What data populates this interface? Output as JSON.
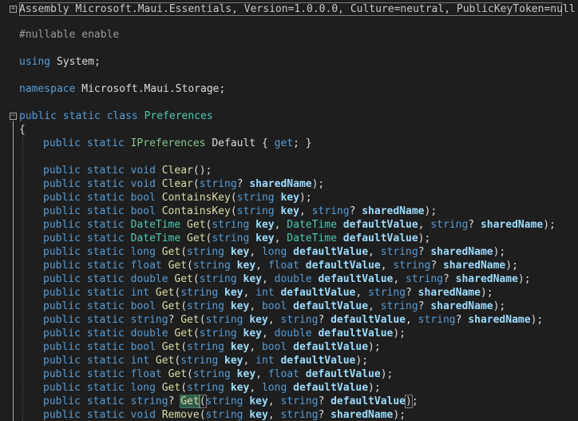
{
  "header": {
    "text": "Assembly Microsoft.Maui.Essentials, Version=1.0.0.0, Culture=neutral, PublicKeyToken=null",
    "expand_glyph": "+"
  },
  "collapse_glyph": "−",
  "preproc": {
    "directive": "#nullable",
    "value": "enable"
  },
  "using": {
    "keyword": "using",
    "name": "System",
    "semi": ";"
  },
  "namespace": {
    "keyword": "namespace",
    "name": "Microsoft.Maui.Storage",
    "semi": ";"
  },
  "class_decl": {
    "public": "public",
    "static": "static",
    "class": "class",
    "name": "Preferences"
  },
  "open_brace": "{",
  "members": [
    [
      [
        "kw",
        "public"
      ],
      [
        "p",
        " "
      ],
      [
        "kw",
        "static"
      ],
      [
        "p",
        " "
      ],
      [
        "st",
        "IPreferences"
      ],
      [
        "p",
        " "
      ],
      [
        "pn",
        "Default"
      ],
      [
        "p",
        " { "
      ],
      [
        "kw",
        "get"
      ],
      [
        "p",
        "; }"
      ]
    ],
    [],
    [
      [
        "kw",
        "public"
      ],
      [
        "p",
        " "
      ],
      [
        "kw",
        "static"
      ],
      [
        "p",
        " "
      ],
      [
        "kw",
        "void"
      ],
      [
        "p",
        " "
      ],
      [
        "fn",
        "Clear"
      ],
      [
        "p",
        "();"
      ]
    ],
    [
      [
        "kw",
        "public"
      ],
      [
        "p",
        " "
      ],
      [
        "kw",
        "static"
      ],
      [
        "p",
        " "
      ],
      [
        "kw",
        "void"
      ],
      [
        "p",
        " "
      ],
      [
        "fn",
        "Clear"
      ],
      [
        "p",
        "("
      ],
      [
        "kw",
        "string"
      ],
      [
        "p",
        "? "
      ],
      [
        "pm",
        "sharedName"
      ],
      [
        "p",
        ");"
      ]
    ],
    [
      [
        "kw",
        "public"
      ],
      [
        "p",
        " "
      ],
      [
        "kw",
        "static"
      ],
      [
        "p",
        " "
      ],
      [
        "kw",
        "bool"
      ],
      [
        "p",
        " "
      ],
      [
        "fn",
        "ContainsKey"
      ],
      [
        "p",
        "("
      ],
      [
        "kw",
        "string"
      ],
      [
        "p",
        " "
      ],
      [
        "pm",
        "key"
      ],
      [
        "p",
        ");"
      ]
    ],
    [
      [
        "kw",
        "public"
      ],
      [
        "p",
        " "
      ],
      [
        "kw",
        "static"
      ],
      [
        "p",
        " "
      ],
      [
        "kw",
        "bool"
      ],
      [
        "p",
        " "
      ],
      [
        "fn",
        "ContainsKey"
      ],
      [
        "p",
        "("
      ],
      [
        "kw",
        "string"
      ],
      [
        "p",
        " "
      ],
      [
        "pm",
        "key"
      ],
      [
        "p",
        ", "
      ],
      [
        "kw",
        "string"
      ],
      [
        "p",
        "? "
      ],
      [
        "pm",
        "sharedName"
      ],
      [
        "p",
        ");"
      ]
    ],
    [
      [
        "kw",
        "public"
      ],
      [
        "p",
        " "
      ],
      [
        "kw",
        "static"
      ],
      [
        "p",
        " "
      ],
      [
        "ty",
        "DateTime"
      ],
      [
        "p",
        " "
      ],
      [
        "fn",
        "Get"
      ],
      [
        "p",
        "("
      ],
      [
        "kw",
        "string"
      ],
      [
        "p",
        " "
      ],
      [
        "pm",
        "key"
      ],
      [
        "p",
        ", "
      ],
      [
        "ty",
        "DateTime"
      ],
      [
        "p",
        " "
      ],
      [
        "pm",
        "defaultValue"
      ],
      [
        "p",
        ", "
      ],
      [
        "kw",
        "string"
      ],
      [
        "p",
        "? "
      ],
      [
        "pm",
        "sharedName"
      ],
      [
        "p",
        ");"
      ]
    ],
    [
      [
        "kw",
        "public"
      ],
      [
        "p",
        " "
      ],
      [
        "kw",
        "static"
      ],
      [
        "p",
        " "
      ],
      [
        "ty",
        "DateTime"
      ],
      [
        "p",
        " "
      ],
      [
        "fn",
        "Get"
      ],
      [
        "p",
        "("
      ],
      [
        "kw",
        "string"
      ],
      [
        "p",
        " "
      ],
      [
        "pm",
        "key"
      ],
      [
        "p",
        ", "
      ],
      [
        "ty",
        "DateTime"
      ],
      [
        "p",
        " "
      ],
      [
        "pm",
        "defaultValue"
      ],
      [
        "p",
        ");"
      ]
    ],
    [
      [
        "kw",
        "public"
      ],
      [
        "p",
        " "
      ],
      [
        "kw",
        "static"
      ],
      [
        "p",
        " "
      ],
      [
        "kw",
        "long"
      ],
      [
        "p",
        " "
      ],
      [
        "fn",
        "Get"
      ],
      [
        "p",
        "("
      ],
      [
        "kw",
        "string"
      ],
      [
        "p",
        " "
      ],
      [
        "pm",
        "key"
      ],
      [
        "p",
        ", "
      ],
      [
        "kw",
        "long"
      ],
      [
        "p",
        " "
      ],
      [
        "pm",
        "defaultValue"
      ],
      [
        "p",
        ", "
      ],
      [
        "kw",
        "string"
      ],
      [
        "p",
        "? "
      ],
      [
        "pm",
        "sharedName"
      ],
      [
        "p",
        ");"
      ]
    ],
    [
      [
        "kw",
        "public"
      ],
      [
        "p",
        " "
      ],
      [
        "kw",
        "static"
      ],
      [
        "p",
        " "
      ],
      [
        "kw",
        "float"
      ],
      [
        "p",
        " "
      ],
      [
        "fn",
        "Get"
      ],
      [
        "p",
        "("
      ],
      [
        "kw",
        "string"
      ],
      [
        "p",
        " "
      ],
      [
        "pm",
        "key"
      ],
      [
        "p",
        ", "
      ],
      [
        "kw",
        "float"
      ],
      [
        "p",
        " "
      ],
      [
        "pm",
        "defaultValue"
      ],
      [
        "p",
        ", "
      ],
      [
        "kw",
        "string"
      ],
      [
        "p",
        "? "
      ],
      [
        "pm",
        "sharedName"
      ],
      [
        "p",
        ");"
      ]
    ],
    [
      [
        "kw",
        "public"
      ],
      [
        "p",
        " "
      ],
      [
        "kw",
        "static"
      ],
      [
        "p",
        " "
      ],
      [
        "kw",
        "double"
      ],
      [
        "p",
        " "
      ],
      [
        "fn",
        "Get"
      ],
      [
        "p",
        "("
      ],
      [
        "kw",
        "string"
      ],
      [
        "p",
        " "
      ],
      [
        "pm",
        "key"
      ],
      [
        "p",
        ", "
      ],
      [
        "kw",
        "double"
      ],
      [
        "p",
        " "
      ],
      [
        "pm",
        "defaultValue"
      ],
      [
        "p",
        ", "
      ],
      [
        "kw",
        "string"
      ],
      [
        "p",
        "? "
      ],
      [
        "pm",
        "sharedName"
      ],
      [
        "p",
        ");"
      ]
    ],
    [
      [
        "kw",
        "public"
      ],
      [
        "p",
        " "
      ],
      [
        "kw",
        "static"
      ],
      [
        "p",
        " "
      ],
      [
        "kw",
        "int"
      ],
      [
        "p",
        " "
      ],
      [
        "fn",
        "Get"
      ],
      [
        "p",
        "("
      ],
      [
        "kw",
        "string"
      ],
      [
        "p",
        " "
      ],
      [
        "pm",
        "key"
      ],
      [
        "p",
        ", "
      ],
      [
        "kw",
        "int"
      ],
      [
        "p",
        " "
      ],
      [
        "pm",
        "defaultValue"
      ],
      [
        "p",
        ", "
      ],
      [
        "kw",
        "string"
      ],
      [
        "p",
        "? "
      ],
      [
        "pm",
        "sharedName"
      ],
      [
        "p",
        ");"
      ]
    ],
    [
      [
        "kw",
        "public"
      ],
      [
        "p",
        " "
      ],
      [
        "kw",
        "static"
      ],
      [
        "p",
        " "
      ],
      [
        "kw",
        "bool"
      ],
      [
        "p",
        " "
      ],
      [
        "fn",
        "Get"
      ],
      [
        "p",
        "("
      ],
      [
        "kw",
        "string"
      ],
      [
        "p",
        " "
      ],
      [
        "pm",
        "key"
      ],
      [
        "p",
        ", "
      ],
      [
        "kw",
        "bool"
      ],
      [
        "p",
        " "
      ],
      [
        "pm",
        "defaultValue"
      ],
      [
        "p",
        ", "
      ],
      [
        "kw",
        "string"
      ],
      [
        "p",
        "? "
      ],
      [
        "pm",
        "sharedName"
      ],
      [
        "p",
        ");"
      ]
    ],
    [
      [
        "kw",
        "public"
      ],
      [
        "p",
        " "
      ],
      [
        "kw",
        "static"
      ],
      [
        "p",
        " "
      ],
      [
        "kw",
        "string"
      ],
      [
        "p",
        "? "
      ],
      [
        "fn",
        "Get"
      ],
      [
        "p",
        "("
      ],
      [
        "kw",
        "string"
      ],
      [
        "p",
        " "
      ],
      [
        "pm",
        "key"
      ],
      [
        "p",
        ", "
      ],
      [
        "kw",
        "string"
      ],
      [
        "p",
        "? "
      ],
      [
        "pm",
        "defaultValue"
      ],
      [
        "p",
        ", "
      ],
      [
        "kw",
        "string"
      ],
      [
        "p",
        "? "
      ],
      [
        "pm",
        "sharedName"
      ],
      [
        "p",
        ");"
      ]
    ],
    [
      [
        "kw",
        "public"
      ],
      [
        "p",
        " "
      ],
      [
        "kw",
        "static"
      ],
      [
        "p",
        " "
      ],
      [
        "kw",
        "double"
      ],
      [
        "p",
        " "
      ],
      [
        "fn",
        "Get"
      ],
      [
        "p",
        "("
      ],
      [
        "kw",
        "string"
      ],
      [
        "p",
        " "
      ],
      [
        "pm",
        "key"
      ],
      [
        "p",
        ", "
      ],
      [
        "kw",
        "double"
      ],
      [
        "p",
        " "
      ],
      [
        "pm",
        "defaultValue"
      ],
      [
        "p",
        ");"
      ]
    ],
    [
      [
        "kw",
        "public"
      ],
      [
        "p",
        " "
      ],
      [
        "kw",
        "static"
      ],
      [
        "p",
        " "
      ],
      [
        "kw",
        "bool"
      ],
      [
        "p",
        " "
      ],
      [
        "fn",
        "Get"
      ],
      [
        "p",
        "("
      ],
      [
        "kw",
        "string"
      ],
      [
        "p",
        " "
      ],
      [
        "pm",
        "key"
      ],
      [
        "p",
        ", "
      ],
      [
        "kw",
        "bool"
      ],
      [
        "p",
        " "
      ],
      [
        "pm",
        "defaultValue"
      ],
      [
        "p",
        ");"
      ]
    ],
    [
      [
        "kw",
        "public"
      ],
      [
        "p",
        " "
      ],
      [
        "kw",
        "static"
      ],
      [
        "p",
        " "
      ],
      [
        "kw",
        "int"
      ],
      [
        "p",
        " "
      ],
      [
        "fn",
        "Get"
      ],
      [
        "p",
        "("
      ],
      [
        "kw",
        "string"
      ],
      [
        "p",
        " "
      ],
      [
        "pm",
        "key"
      ],
      [
        "p",
        ", "
      ],
      [
        "kw",
        "int"
      ],
      [
        "p",
        " "
      ],
      [
        "pm",
        "defaultValue"
      ],
      [
        "p",
        ");"
      ]
    ],
    [
      [
        "kw",
        "public"
      ],
      [
        "p",
        " "
      ],
      [
        "kw",
        "static"
      ],
      [
        "p",
        " "
      ],
      [
        "kw",
        "float"
      ],
      [
        "p",
        " "
      ],
      [
        "fn",
        "Get"
      ],
      [
        "p",
        "("
      ],
      [
        "kw",
        "string"
      ],
      [
        "p",
        " "
      ],
      [
        "pm",
        "key"
      ],
      [
        "p",
        ", "
      ],
      [
        "kw",
        "float"
      ],
      [
        "p",
        " "
      ],
      [
        "pm",
        "defaultValue"
      ],
      [
        "p",
        ");"
      ]
    ],
    [
      [
        "kw",
        "public"
      ],
      [
        "p",
        " "
      ],
      [
        "kw",
        "static"
      ],
      [
        "p",
        " "
      ],
      [
        "kw",
        "long"
      ],
      [
        "p",
        " "
      ],
      [
        "fn",
        "Get"
      ],
      [
        "p",
        "("
      ],
      [
        "kw",
        "string"
      ],
      [
        "p",
        " "
      ],
      [
        "pm",
        "key"
      ],
      [
        "p",
        ", "
      ],
      [
        "kw",
        "long"
      ],
      [
        "p",
        " "
      ],
      [
        "pm",
        "defaultValue"
      ],
      [
        "p",
        ");"
      ]
    ],
    [
      [
        "kw",
        "public"
      ],
      [
        "p",
        " "
      ],
      [
        "kw",
        "static"
      ],
      [
        "p",
        " "
      ],
      [
        "kw",
        "string"
      ],
      [
        "p",
        "? "
      ],
      [
        "fnhl",
        "Get"
      ],
      [
        "bm",
        "("
      ],
      [
        "kw",
        "string"
      ],
      [
        "p",
        " "
      ],
      [
        "pm",
        "key"
      ],
      [
        "p",
        ", "
      ],
      [
        "kw",
        "string"
      ],
      [
        "p",
        "? "
      ],
      [
        "pm",
        "defaultValue"
      ],
      [
        "bm",
        ")"
      ],
      [
        "p",
        ";"
      ]
    ],
    [
      [
        "kw",
        "public"
      ],
      [
        "p",
        " "
      ],
      [
        "kw",
        "static"
      ],
      [
        "p",
        " "
      ],
      [
        "kw",
        "void"
      ],
      [
        "p",
        " "
      ],
      [
        "fn",
        "Remove"
      ],
      [
        "p",
        "("
      ],
      [
        "kw",
        "string"
      ],
      [
        "p",
        " "
      ],
      [
        "pm",
        "key"
      ],
      [
        "p",
        ", "
      ],
      [
        "kw",
        "string"
      ],
      [
        "p",
        "? "
      ],
      [
        "pm",
        "sharedName"
      ],
      [
        "p",
        ");"
      ]
    ]
  ],
  "colors": {
    "background": "#1e1e1e",
    "keyword": "#569cd6",
    "type_struct": "#4ec9b0",
    "type_interface": "#86c691",
    "method": "#dcdcaa",
    "parameter": "#9cdcfe",
    "highlight": "#2f5b48"
  }
}
